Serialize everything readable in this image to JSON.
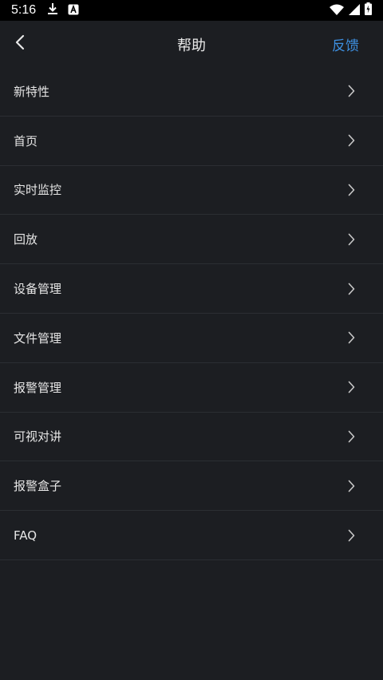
{
  "status_bar": {
    "time": "5:16",
    "icons": [
      "download-icon",
      "a-notification-icon",
      "wifi-icon",
      "signal-icon",
      "battery-charging-icon"
    ]
  },
  "header": {
    "title": "帮助",
    "feedback_label": "反馈"
  },
  "menu": {
    "items": [
      {
        "label": "新特性"
      },
      {
        "label": "首页"
      },
      {
        "label": "实时监控"
      },
      {
        "label": "回放"
      },
      {
        "label": "设备管理"
      },
      {
        "label": "文件管理"
      },
      {
        "label": "报警管理"
      },
      {
        "label": "可视对讲"
      },
      {
        "label": "报警盒子"
      },
      {
        "label": "FAQ"
      }
    ]
  },
  "colors": {
    "background": "#1c1e22",
    "accent": "#3d8fe0",
    "divider": "#2b2e33",
    "text": "#e6e6e6"
  }
}
